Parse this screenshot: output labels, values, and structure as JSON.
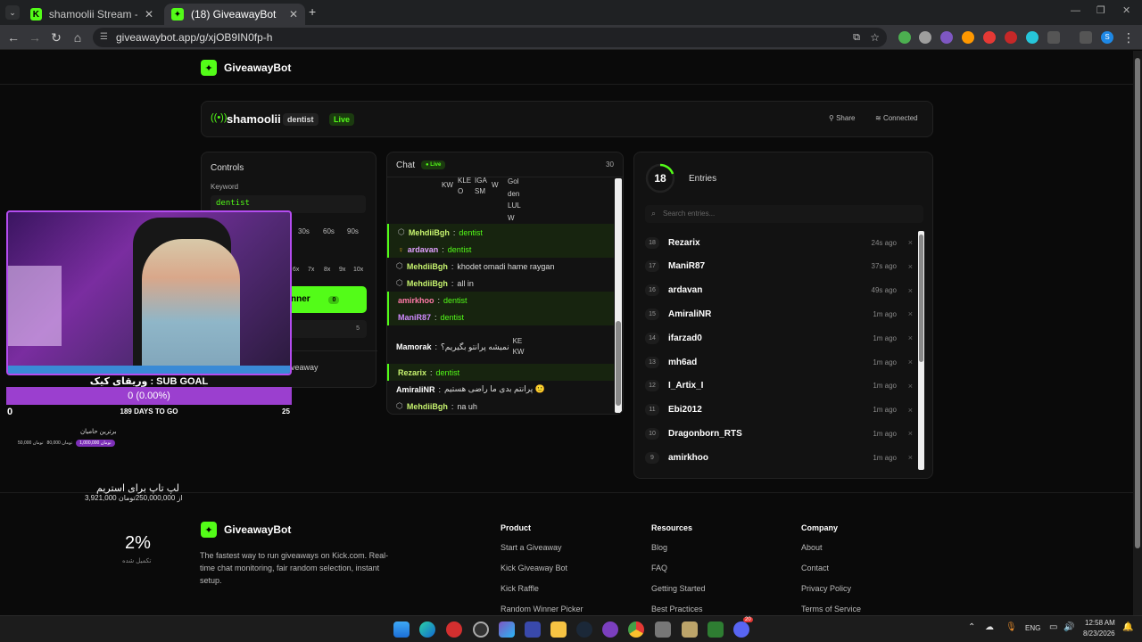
{
  "browser": {
    "tabs": [
      {
        "title": "shamoolii Stream - Watch Live o"
      },
      {
        "title": "(18) GiveawayBot"
      }
    ],
    "url": "giveawaybot.app/g/xjOB9IN0fp-h"
  },
  "header": {
    "brand": "GiveawayBot"
  },
  "streamer": {
    "name": "shamoolii",
    "keyword_badge": "dentist",
    "live_badge": "Live",
    "share_label": "Share",
    "connected_label": "Connected"
  },
  "controls": {
    "title": "Controls",
    "keyword_label": "Keyword",
    "keyword_value": "dentist",
    "time_options": [
      "30s",
      "60s",
      "90s"
    ],
    "multiplier_options": [
      "6x",
      "7x",
      "8x",
      "9x",
      "10x"
    ],
    "winner_label": "nner",
    "winner_count": "0",
    "value_badge": "5",
    "giveaway_label": "veaway"
  },
  "chat": {
    "title": "Chat",
    "live_badge": "Live",
    "count": "30",
    "emote_fragments": [
      "KW",
      "KLE O",
      "IGA SM",
      "W",
      "Gol den LUL W"
    ],
    "messages": [
      {
        "user": "MehdiiBgh",
        "text": "dentist",
        "color": "#c7f36f",
        "highlight": true,
        "icon": "⬡"
      },
      {
        "user": "ardavan",
        "text": "dentist",
        "color": "#e0a0ff",
        "highlight": true,
        "icon": "♀"
      },
      {
        "user": "MehdiiBgh",
        "text": "khodet omadi hame raygan",
        "color": "#c7f36f",
        "highlight": false,
        "icon": "⬡"
      },
      {
        "user": "MehdiiBgh",
        "text": "all in",
        "color": "#c7f36f",
        "highlight": false,
        "icon": "⬡"
      },
      {
        "user": "amirkhoo",
        "text": "dentist",
        "color": "#ff7aa8",
        "highlight": true,
        "icon": ""
      },
      {
        "user": "ManiR87",
        "text": "dentist",
        "color": "#d08bff",
        "highlight": true,
        "icon": ""
      }
    ],
    "mamorak": {
      "user": "Mamorak",
      "text": "نمیشه پرانتو بگیریم؟",
      "emote": "KE KW"
    },
    "messages2": [
      {
        "user": "Rezarix",
        "text": "dentist",
        "color": "#c7f36f",
        "highlight": true,
        "icon": ""
      },
      {
        "user": "AmiraliNR",
        "text": "پرانتم بدی ما راضی هستیم 🙂",
        "color": "#ffffff",
        "highlight": false,
        "icon": ""
      },
      {
        "user": "MehdiiBgh",
        "text": "na uh",
        "color": "#c7f36f",
        "highlight": false,
        "icon": "⬡"
      }
    ]
  },
  "entries": {
    "count": "18",
    "title": "Entries",
    "search_placeholder": "Search entries...",
    "list": [
      {
        "num": "18",
        "name": "Rezarix",
        "time": "24s ago"
      },
      {
        "num": "17",
        "name": "ManiR87",
        "time": "37s ago"
      },
      {
        "num": "16",
        "name": "ardavan",
        "time": "49s ago"
      },
      {
        "num": "15",
        "name": "AmiraliNR",
        "time": "1m ago"
      },
      {
        "num": "14",
        "name": "ifarzad0",
        "time": "1m ago"
      },
      {
        "num": "13",
        "name": "mh6ad",
        "time": "1m ago"
      },
      {
        "num": "12",
        "name": "I_Artix_I",
        "time": "1m ago"
      },
      {
        "num": "11",
        "name": "Ebi2012",
        "time": "1m ago"
      },
      {
        "num": "10",
        "name": "Dragonborn_RTS",
        "time": "1m ago"
      },
      {
        "num": "9",
        "name": "amirkhoo",
        "time": "1m ago"
      }
    ],
    "remove_glyph": "×"
  },
  "overlay": {
    "sub_goal": "وریقای کیک : SUB GOAL",
    "goal_value": "0 (0.00%)",
    "goal_progress": 0,
    "goal_min": "0",
    "goal_max": "25",
    "days_left": "189 DAYS TO GO",
    "top_supporters": "برترین حامیان",
    "donor_amount": "1,000,000 تومان",
    "donor_2": "80,000 تومان",
    "donor_3": "50,000 تومان",
    "laptop_title": "لپ تاپ برای استریم",
    "laptop_amount": "3,921,000 از 250,000,000تومان",
    "percent": "2%",
    "percent_label": "تکمیل شده"
  },
  "footer": {
    "brand": "GiveawayBot",
    "tagline": "The fastest way to run giveaways on Kick.com. Real-time chat monitoring, fair random selection, instant setup.",
    "columns": [
      {
        "title": "Product",
        "links": [
          "Start a Giveaway",
          "Kick Giveaway Bot",
          "Kick Raffle",
          "Random Winner Picker"
        ]
      },
      {
        "title": "Resources",
        "links": [
          "Blog",
          "FAQ",
          "Getting Started",
          "Best Practices"
        ]
      },
      {
        "title": "Company",
        "links": [
          "About",
          "Contact",
          "Privacy Policy",
          "Terms of Service"
        ]
      }
    ]
  },
  "taskbar": {
    "lang": "ENG",
    "time": "12:58 AM",
    "date": "8/23/2026",
    "discord_badge": "20"
  },
  "colors": {
    "accent": "#53fc18",
    "panel": "#121212"
  }
}
